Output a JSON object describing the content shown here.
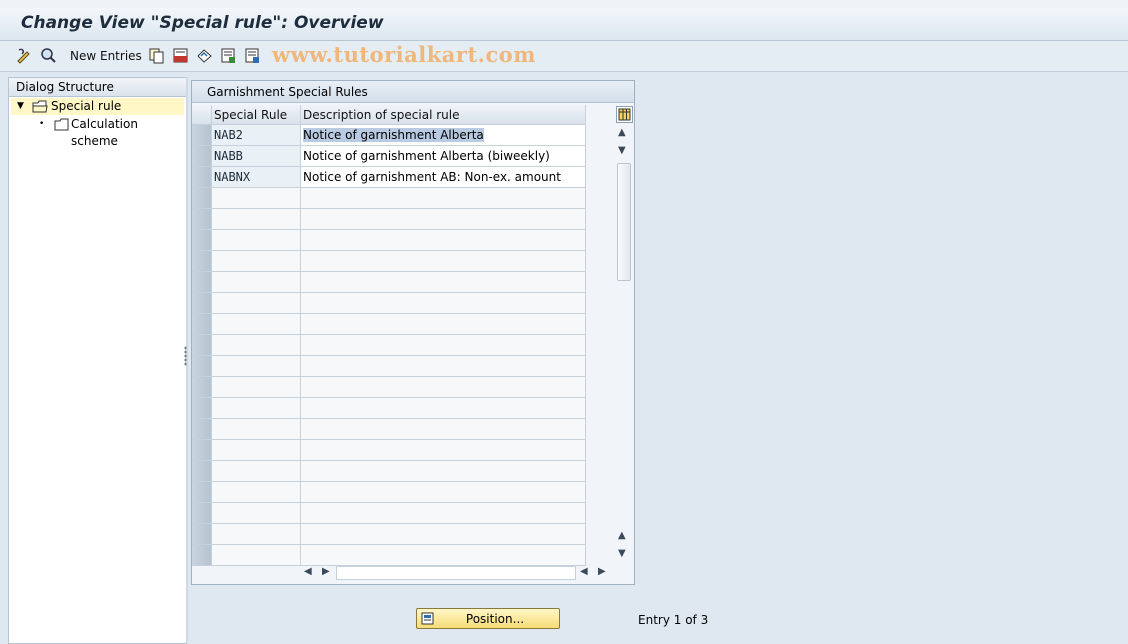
{
  "window": {
    "title": "Change View \"Special rule\": Overview"
  },
  "toolbar": {
    "new_entries_label": "New Entries",
    "icons": [
      "display-change-icon",
      "find-icon",
      "copy-as-icon",
      "delete-icon",
      "undo-change-icon",
      "select-all-icon",
      "select-block-icon"
    ]
  },
  "watermark": "www.tutorialkart.com",
  "dialog_structure": {
    "header": "Dialog Structure",
    "items": [
      {
        "label": "Special rule",
        "selected": true,
        "expanded": true
      },
      {
        "label": "Calculation scheme",
        "selected": false
      }
    ]
  },
  "table": {
    "title": "Garnishment Special Rules",
    "columns": [
      "Special Rule",
      "Description of special rule"
    ],
    "rows": [
      {
        "rule": "NAB2",
        "description": "Notice of garnishment Alberta"
      },
      {
        "rule": "NABB",
        "description": "Notice of garnishment Alberta (biweekly)"
      },
      {
        "rule": "NABNX",
        "description": "Notice of garnishment AB: Non-ex. amount"
      }
    ]
  },
  "footer": {
    "position_button": "Position...",
    "entry_status": "Entry 1 of 3"
  }
}
